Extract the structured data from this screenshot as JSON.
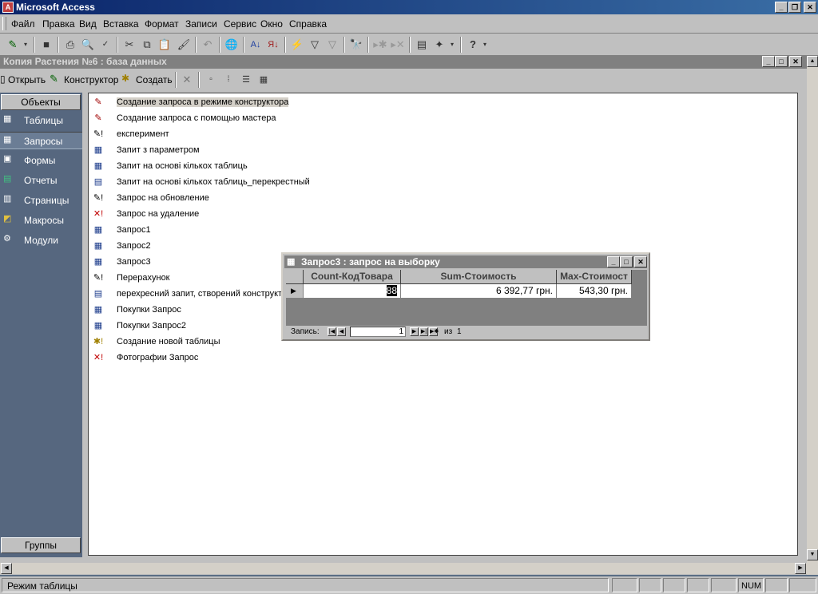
{
  "app": {
    "title": "Microsoft Access"
  },
  "menu": [
    "Файл",
    "Правка",
    "Вид",
    "Вставка",
    "Формат",
    "Записи",
    "Сервис",
    "Окно",
    "Справка"
  ],
  "db": {
    "title": "Копия Растения №6 : база данных",
    "toolbar": {
      "open": "Открыть",
      "design": "Конструктор",
      "create": "Создать"
    },
    "objects_header": "Объекты",
    "groups_label": "Группы",
    "objects": [
      {
        "label": "Таблицы",
        "icon": "table-icon"
      },
      {
        "label": "Запросы",
        "icon": "query-icon",
        "selected": true
      },
      {
        "label": "Формы",
        "icon": "form-icon"
      },
      {
        "label": "Отчеты",
        "icon": "report-icon"
      },
      {
        "label": "Страницы",
        "icon": "page-icon"
      },
      {
        "label": "Макросы",
        "icon": "macro-icon"
      },
      {
        "label": "Модули",
        "icon": "module-icon"
      }
    ],
    "items": [
      {
        "label": "Создание запроса в режиме конструктора",
        "icon": "wizard-icon",
        "glyph": "✎"
      },
      {
        "label": "Создание запроса с помощью мастера",
        "icon": "wizard-icon",
        "glyph": "✎"
      },
      {
        "label": "експеримент",
        "icon": "update-query-icon",
        "glyph": "✎!"
      },
      {
        "label": "Запит з параметром",
        "icon": "select-query-icon",
        "glyph": "▦"
      },
      {
        "label": "Запит на основі кількох таблиць",
        "icon": "select-query-icon",
        "glyph": "▦"
      },
      {
        "label": "Запит на основі кількох таблиць_перекрестный",
        "icon": "crosstab-query-icon",
        "glyph": "▤"
      },
      {
        "label": "Запрос на обновление",
        "icon": "update-query-icon",
        "glyph": "✎!"
      },
      {
        "label": "Запрос на удаление",
        "icon": "delete-query-icon",
        "glyph": "✕!"
      },
      {
        "label": "Запрос1",
        "icon": "select-query-icon",
        "glyph": "▦"
      },
      {
        "label": "Запрос2",
        "icon": "select-query-icon",
        "glyph": "▦"
      },
      {
        "label": "Запрос3",
        "icon": "select-query-icon",
        "glyph": "▦"
      },
      {
        "label": "Перерахунок",
        "icon": "update-query-icon",
        "glyph": "✎!"
      },
      {
        "label": "перехресний запит, створений конструктором",
        "icon": "crosstab-query-icon",
        "glyph": "▤"
      },
      {
        "label": "Покупки Запрос",
        "icon": "select-query-icon",
        "glyph": "▦"
      },
      {
        "label": "Покупки Запрос2",
        "icon": "select-query-icon",
        "glyph": "▦"
      },
      {
        "label": "Создание новой таблицы",
        "icon": "make-table-query-icon",
        "glyph": "✱!"
      },
      {
        "label": "Фотографии Запрос",
        "icon": "delete-query-icon",
        "glyph": "✕!"
      }
    ]
  },
  "query_window": {
    "title": "Запрос3 : запрос на выборку",
    "columns": [
      "Count-КодТовара",
      "Sum-Стоимость",
      "Max-Стоимост"
    ],
    "row": [
      "88",
      "6 392,77 грн.",
      "543,30 грн."
    ],
    "nav": {
      "label": "Запись:",
      "current": "1",
      "of_label": "из",
      "total": "1"
    }
  },
  "status": {
    "text": "Режим таблицы",
    "num": "NUM"
  }
}
